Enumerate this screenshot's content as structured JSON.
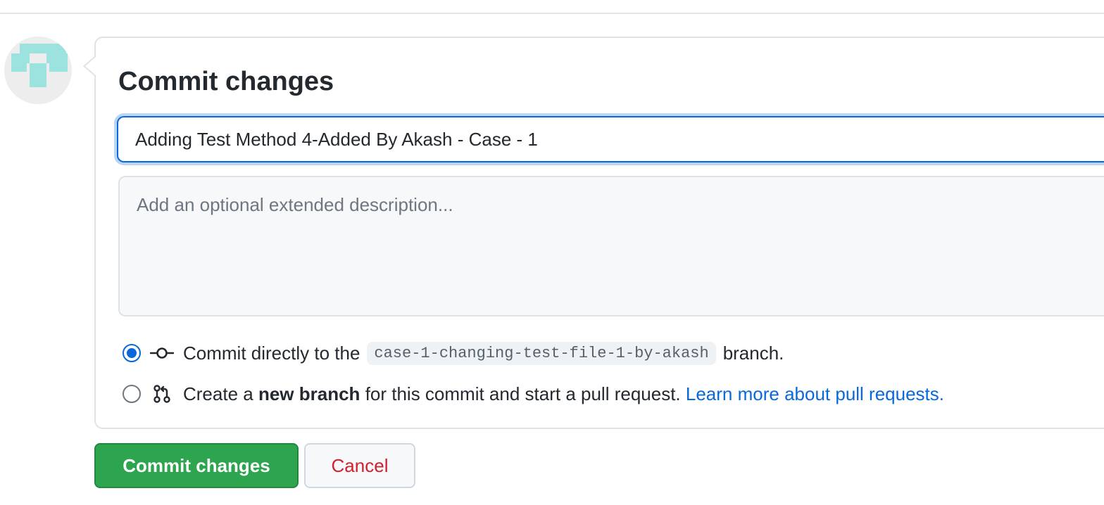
{
  "commit_form": {
    "title": "Commit changes",
    "summary_value": "Adding Test Method 4-Added By Akash - Case - 1",
    "description_placeholder": "Add an optional extended description...",
    "options": {
      "direct": {
        "text_before": "Commit directly to the",
        "branch_name": "case-1-changing-test-file-1-by-akash",
        "text_after": "branch.",
        "selected": true,
        "icon": "git-commit-icon"
      },
      "new_branch": {
        "text_before": "Create a",
        "bold_text": "new branch",
        "text_after": "for this commit and start a pull request.",
        "link_text": "Learn more about pull requests.",
        "selected": false,
        "icon": "git-pull-request-icon"
      }
    },
    "buttons": {
      "commit_label": "Commit changes",
      "cancel_label": "Cancel"
    }
  },
  "colors": {
    "primary_button": "#2da44e",
    "link": "#0969da",
    "cancel_text": "#cf222e",
    "avatar_identicon": "#9ce3df"
  }
}
